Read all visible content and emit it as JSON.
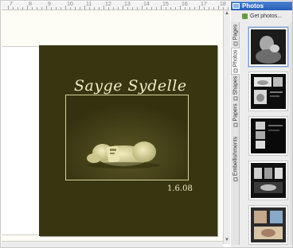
{
  "ruler": {
    "labels": [
      "7",
      "8",
      "9",
      "10",
      "11",
      "12",
      "13",
      "14",
      "15",
      "16",
      "17",
      "18"
    ]
  },
  "canvas": {
    "title": "Sayge Sydelle",
    "date": "1.6.08",
    "page_color": "#383511",
    "frame_color": "#d8d39e"
  },
  "panel": {
    "title": "Photos",
    "get_photos_label": "Get photos...",
    "tabs": [
      {
        "label": "Pages",
        "icon": "pages-icon"
      },
      {
        "label": "Photos",
        "icon": "photos-icon"
      },
      {
        "label": "Shapes",
        "icon": "shapes-icon"
      },
      {
        "label": "Papers",
        "icon": "papers-icon"
      },
      {
        "label": "Embellishments",
        "icon": "embellishments-icon"
      }
    ],
    "thumbnails": [
      {
        "name": "photo-thumb-1",
        "style": "portrait"
      },
      {
        "name": "photo-thumb-2",
        "style": "layout-white-boxes"
      },
      {
        "name": "photo-thumb-3",
        "style": "layout-strip"
      },
      {
        "name": "photo-thumb-4",
        "style": "layout-grid"
      },
      {
        "name": "photo-thumb-5",
        "style": "layout-color"
      }
    ],
    "header_color": "#2a5eb8"
  }
}
